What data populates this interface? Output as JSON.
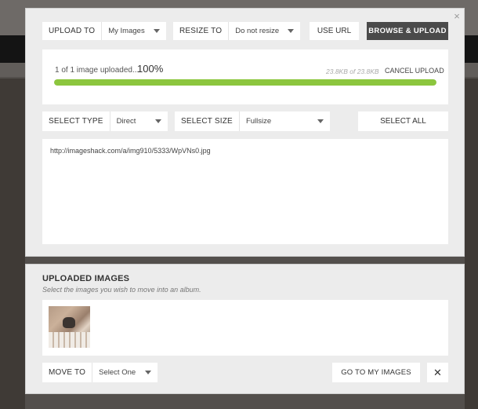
{
  "upload_bar": {
    "upload_to_label": "UPLOAD TO",
    "upload_to_value": "My Images",
    "resize_to_label": "RESIZE TO",
    "resize_to_value": "Do not resize",
    "use_url_label": "USE URL",
    "browse_upload_label": "BROWSE & UPLOAD",
    "close_symbol": "×"
  },
  "progress": {
    "status_text": "1 of 1 image uploaded...",
    "percent_text": "100%",
    "percent": 100,
    "size_text": "23.8KB of 23.8KB",
    "cancel_label": "CANCEL UPLOAD",
    "bar_color": "#8cc63e"
  },
  "select_bar": {
    "type_label": "SELECT TYPE",
    "type_value": "Direct",
    "size_label": "SELECT SIZE",
    "size_value": "Fullsize",
    "select_all_label": "SELECT ALL"
  },
  "url_output": {
    "url": "http://imageshack.com/a/img910/5333/WpVNs0.jpg"
  },
  "uploaded": {
    "title": "UPLOADED IMAGES",
    "subtitle": "Select the images you wish to move into an album.",
    "move_to_label": "MOVE TO",
    "move_to_value": "Select One",
    "goto_label": "GO TO MY IMAGES",
    "close_symbol": "✕"
  }
}
